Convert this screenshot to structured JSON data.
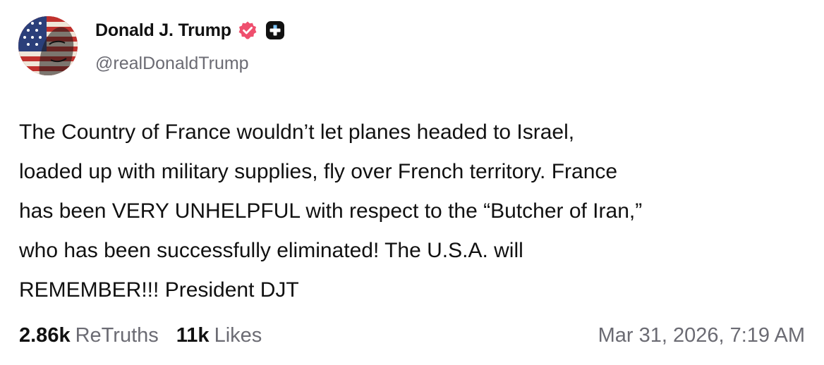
{
  "author": {
    "display_name": "Donald J. Trump",
    "handle": "@realDonaldTrump",
    "verified_color": "#ef4f6e",
    "avatar_icon": "flag-portrait-avatar"
  },
  "post": {
    "lines": [
      "The Country of France wouldn’t let planes headed to Israel,",
      "loaded up with military supplies, fly over French territory. France",
      "has been VERY UNHELPFUL with respect to the “Butcher of Iran,”",
      "who has been successfully eliminated! The U.S.A. will",
      "REMEMBER!!! President DJT"
    ]
  },
  "stats": {
    "retruths_count": "2.86k",
    "retruths_label": "ReTruths",
    "likes_count": "11k",
    "likes_label": "Likes",
    "timestamp": "Mar 31, 2026, 7:19 AM"
  }
}
